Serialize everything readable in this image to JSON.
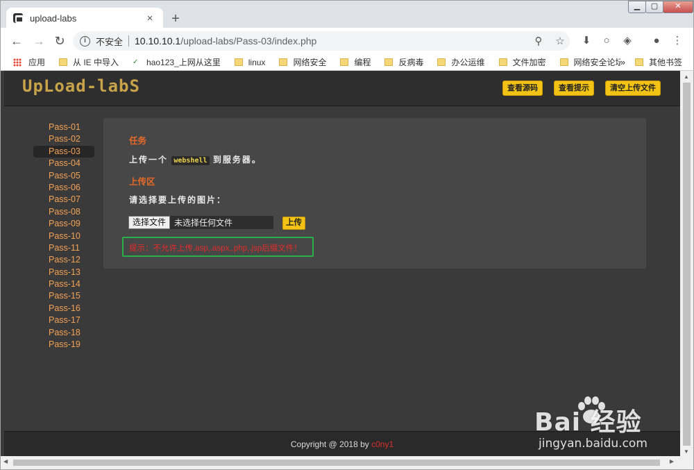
{
  "browser": {
    "tab_title": "upload-labs",
    "tab_close": "×",
    "new_tab": "+",
    "security_label": "不安全",
    "url_host": "10.10.10.1",
    "url_path": "/upload-labs/Pass-03/index.php",
    "bookmarks": [
      "应用",
      "从 IE 中导入",
      "hao123_上网从这里",
      "linux",
      "网络安全",
      "编程",
      "反病毒",
      "办公运维",
      "文件加密",
      "网络安全论坛"
    ],
    "bookmarks_more": "»",
    "other_bookmarks": "其他书签"
  },
  "header": {
    "logo": "UpLoad-labS",
    "buttons": [
      "查看源码",
      "查看提示",
      "清空上传文件"
    ]
  },
  "sidebar": {
    "items": [
      "Pass-01",
      "Pass-02",
      "Pass-03",
      "Pass-04",
      "Pass-05",
      "Pass-06",
      "Pass-07",
      "Pass-08",
      "Pass-09",
      "Pass-10",
      "Pass-11",
      "Pass-12",
      "Pass-13",
      "Pass-14",
      "Pass-15",
      "Pass-16",
      "Pass-17",
      "Pass-18",
      "Pass-19"
    ],
    "active": "Pass-03"
  },
  "main": {
    "task_title": "任务",
    "task_prefix": "上传一个",
    "task_code": "webshell",
    "task_suffix": "到服务器。",
    "upload_title": "上传区",
    "choose_label": "请选择要上传的图片：",
    "file_button": "选择文件",
    "file_placeholder": "未选择任何文件",
    "upload_button": "上传",
    "hint": "提示：不允许上传.asp,.aspx,.php,.jsp后缀文件！"
  },
  "footer": {
    "copyright": "Copyright @ 2018 by ",
    "author": "c0ny1"
  },
  "watermark": {
    "brand": "Bai 经验",
    "url": "jingyan.baidu.com"
  },
  "colors": {
    "accent_yellow": "#f2c314",
    "link_orange": "#f4a255",
    "title_orange": "#e76a28",
    "hint_red": "#e52b2b",
    "highlight_green": "#27b049"
  }
}
